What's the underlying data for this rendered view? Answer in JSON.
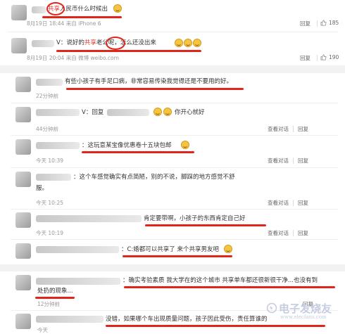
{
  "comments": [
    {
      "text_pre": "",
      "text_hl": "共享",
      "text_post": "人民币什么时候出",
      "time": "8月19日 18:44 来自 iPhone 6",
      "reply": "回复",
      "likes": "185"
    },
    {
      "text_pre": "V：说好的",
      "text_hl": "共享",
      "text_post": "老公呢，怎么还没出来",
      "time": "8月19日 20:04 来自 微博 weibo.com",
      "reply": "回复",
      "likes": "190"
    },
    {
      "text": "有些小孩子有手足口病，非常容易传染我觉得还是不要用的好。",
      "time": "22分钟前"
    },
    {
      "text_pre": "V：回复",
      "text_post": "你开心就好",
      "time": "44分钟前",
      "view": "查看对话",
      "reply": "回复"
    },
    {
      "text": "：这玩意某宝像优惠卷十五块包邮",
      "time": "今天 10:39",
      "view": "查看对话",
      "reply": "回复"
    },
    {
      "text1": "：这个车感觉确实有点简陋，别的不说，脚踩的地方感觉不舒",
      "text2": "服。",
      "time": "今天 10:25",
      "view": "查看对话",
      "reply": "回复"
    },
    {
      "text": "肯定要带啊，小孩子的东西肯定自己好",
      "time": "今天 10:19",
      "view": "查看对话",
      "reply": "回复"
    },
    {
      "text": "：C:婚都可以共享了 来个共享男友吧",
      "time": ""
    },
    {
      "text1": "：确实考验素质 我大学在的这个城市 共享单车都还很新很干净...也没有到",
      "text2": "处扔的现象...",
      "time": "12分钟前",
      "reply": "回复"
    },
    {
      "text": "没错，如果哪个车出现质量问题，孩子因此受伤，责任算谁的",
      "time": "今天"
    }
  ],
  "watermark": "电子发烧友",
  "watermark_sub": "www.elecfans.com",
  "icons": {
    "thumb": "thumb-up-icon",
    "emoji": "grin-emoji-icon"
  },
  "colors": {
    "highlight": "#e03a2f",
    "underline": "#e0261b",
    "meta": "#999999"
  }
}
